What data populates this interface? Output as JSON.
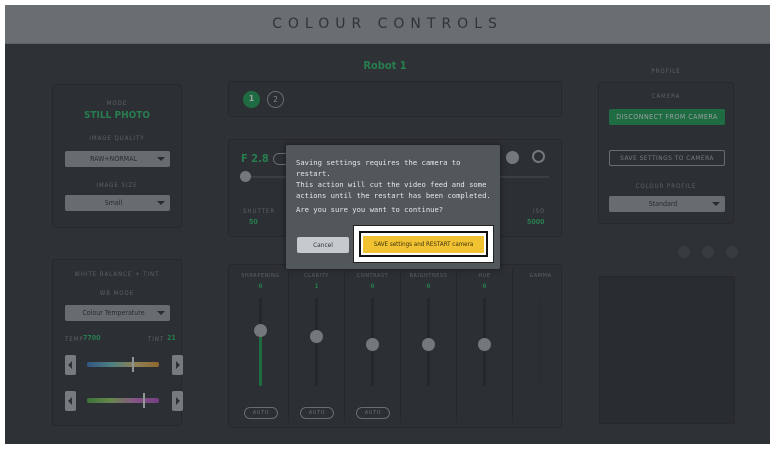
{
  "app": {
    "title": "COLOUR CONTROLS",
    "robot_name": "Robot 1"
  },
  "mode": {
    "label": "MODE",
    "value": "STILL PHOTO"
  },
  "image_quality": {
    "label": "IMAGE QUALITY",
    "value": "RAW+NORMAL"
  },
  "image_size": {
    "label": "IMAGE SIZE",
    "value": "Small"
  },
  "white_balance": {
    "section_label": "WHITE BALANCE + TINT",
    "wb_mode_label": "WB MODE",
    "wb_mode_value": "Colour Temperature",
    "temp_label": "TEMP",
    "temp_value": "7700",
    "tint_label": "TINT",
    "tint_value": "21",
    "temp_slider_level": 0.62,
    "tint_slider_level": 0.78
  },
  "robots": {
    "items": [
      "1",
      "2"
    ]
  },
  "exposure": {
    "aperture": "F 2.8",
    "shutter_label": "SHUTTER",
    "shutter_value": "50",
    "iso_label": "ISO",
    "iso_value": "5000"
  },
  "image_controls": [
    {
      "label": "SHARPENING",
      "value": "0",
      "level": 0.5,
      "auto": "AUTO"
    },
    {
      "label": "CLARITY",
      "value": "1",
      "level": 0.5,
      "auto": "AUTO"
    },
    {
      "label": "CONTRAST",
      "value": "0",
      "level": 0.5,
      "auto": "AUTO"
    },
    {
      "label": "BRIGHTNESS",
      "value": "0",
      "level": 0.5
    },
    {
      "label": "HUE",
      "value": "0",
      "level": 0.5
    },
    {
      "label": "GAMMA",
      "value": ""
    }
  ],
  "profile": {
    "section_label": "PROFILE",
    "camera_label": "CAMERA",
    "disconnect_label": "DISCONNECT FROM CAMERA",
    "save_settings_label": "SAVE SETTINGS TO CAMERA",
    "colour_profile_label": "COLOUR PROFILE",
    "colour_profile_value": "Standard"
  },
  "dialog": {
    "message": "Saving settings requires the camera to restart. This video will cut the video feed and some actions until the restart has been completed.",
    "line1": "Saving settings requires the camera to restart.",
    "line2": "This action will cut the video feed and some",
    "line3": "actions until the restart has been completed.",
    "question": "Are you sure you want to continue?",
    "cancel_label": "Cancel",
    "confirm_label": "SAVE settings and RESTART camera"
  },
  "colors": {
    "accent": "#2fbf6f",
    "confirm": "#f1c232",
    "background": "#3a3f44",
    "titlebar": "#a2a5a8"
  }
}
